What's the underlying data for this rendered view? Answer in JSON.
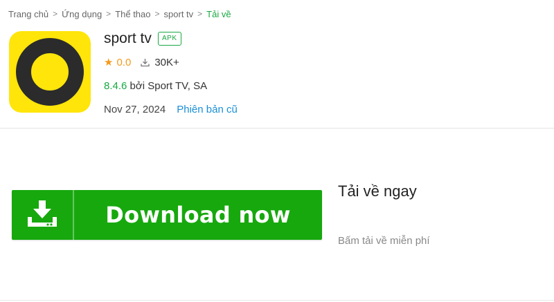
{
  "breadcrumb": {
    "items": [
      "Trang chủ",
      "Ứng dụng",
      "Thể thao",
      "sport tv"
    ],
    "current": "Tải về",
    "separator": ">"
  },
  "app": {
    "name": "sport tv",
    "badge": "APK",
    "rating": "0.0",
    "downloads": "30K+",
    "version": "8.4.6",
    "by_text": " bởi Sport TV, SA",
    "date": "Nov 27, 2024",
    "old_versions_label": "Phiên bản cũ",
    "icon": "yellow-ring-logo"
  },
  "download": {
    "button_label": "Download now",
    "title": "Tải về ngay",
    "subtitle": "Bấm tải về miễn phí"
  },
  "colors": {
    "accent_green": "#17a841",
    "button_green": "#17a80e",
    "link_blue": "#1a8fd6",
    "star_orange": "#f39a1b",
    "logo_yellow": "#ffe50a"
  }
}
